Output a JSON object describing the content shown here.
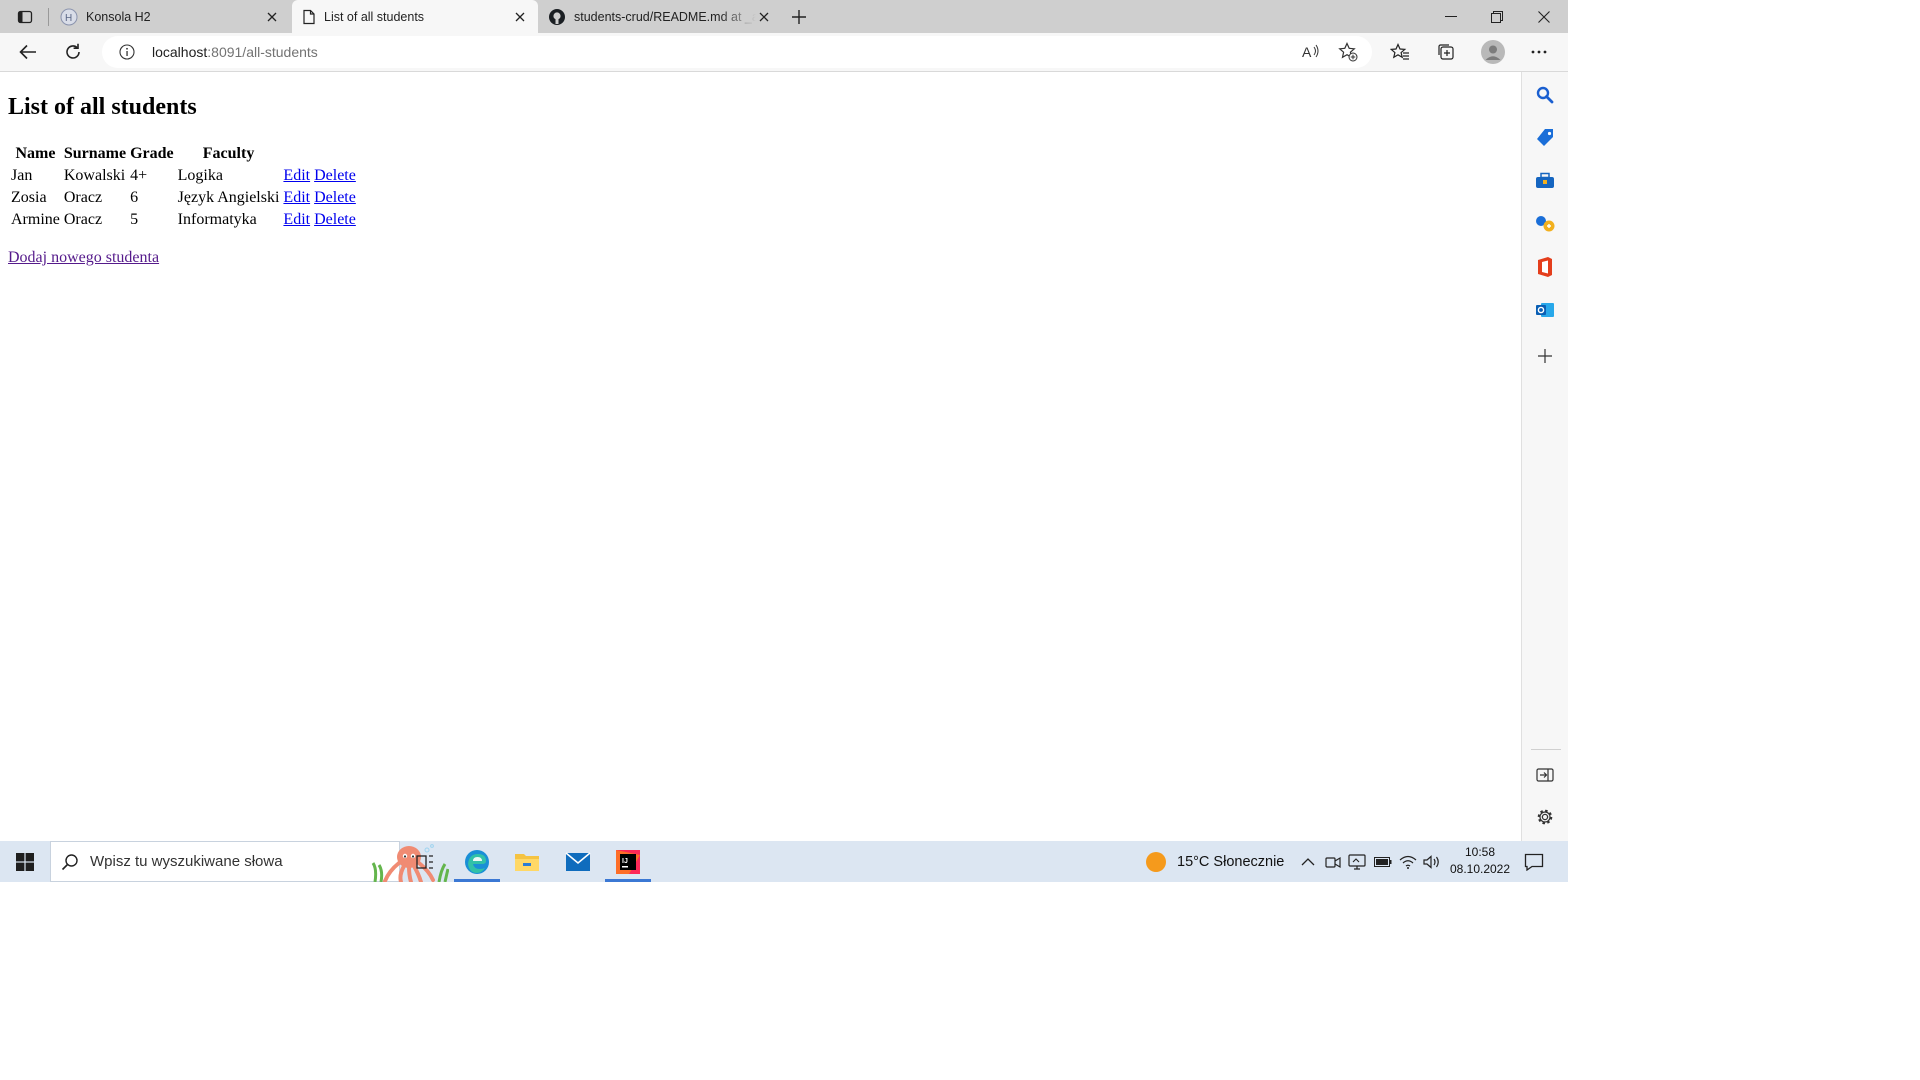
{
  "tabs": [
    {
      "title": "Konsola H2",
      "active": false
    },
    {
      "title": "List of all students",
      "active": true
    },
    {
      "title": "students-crud/README.md at _a",
      "active": false
    }
  ],
  "address": {
    "host": "localhost",
    "path": ":8091/all-students"
  },
  "page": {
    "title": "List of all students",
    "table": {
      "headers": [
        "Name",
        "Surname",
        "Grade",
        "Faculty"
      ],
      "rows": [
        {
          "name": "Jan",
          "surname": "Kowalski",
          "grade": "4+",
          "faculty": "Logika",
          "edit": "Edit",
          "delete": "Delete"
        },
        {
          "name": "Zosia",
          "surname": "Oracz",
          "grade": "6",
          "faculty": "Język Angielski",
          "edit": "Edit",
          "delete": "Delete"
        },
        {
          "name": "Armine",
          "surname": "Oracz",
          "grade": "5",
          "faculty": "Informatyka",
          "edit": "Edit",
          "delete": "Delete"
        }
      ]
    },
    "add_link": "Dodaj nowego studenta"
  },
  "taskbar": {
    "search_placeholder": "Wpisz tu wyszukiwane słowa",
    "weather": "15°C  Słonecznie",
    "time": "10:58",
    "date": "08.10.2022"
  },
  "colors": {
    "link": "#0000ee",
    "visited_link": "#551a8b",
    "taskbar": "#dce6f2",
    "active_indicator": "#3b78d4"
  },
  "icons": {
    "tabstrip": [
      "tab-actions-icon",
      "h2-console-favicon",
      "page-favicon",
      "github-favicon",
      "close-icon",
      "new-tab-icon",
      "minimize-icon",
      "restore-icon",
      "close-window-icon"
    ],
    "toolbar": [
      "back-icon",
      "refresh-icon",
      "site-info-icon",
      "read-aloud-icon",
      "add-favorite-icon",
      "favorites-icon",
      "collections-icon",
      "profile-avatar",
      "more-icon"
    ],
    "sidebar": [
      "search-icon",
      "shopping-icon",
      "tools-icon",
      "games-icon",
      "office-icon",
      "outlook-icon",
      "add-icon",
      "hide-sidebar-icon",
      "settings-icon"
    ],
    "taskbar": [
      "windows-start-icon",
      "search-icon",
      "task-view-icon",
      "edge-icon",
      "file-explorer-icon",
      "mail-icon",
      "intellij-icon",
      "weather-sun-icon",
      "tray-chevron-icon",
      "meet-icon",
      "display-icon",
      "battery-icon",
      "wifi-icon",
      "volume-icon",
      "notifications-icon"
    ]
  }
}
